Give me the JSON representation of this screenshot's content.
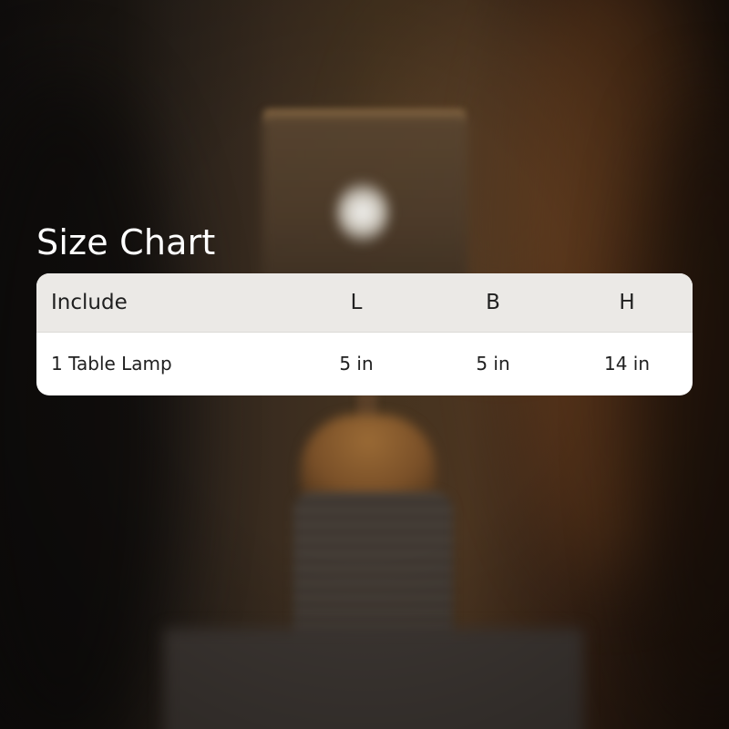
{
  "title": "Size Chart",
  "table": {
    "headers": {
      "include": "Include",
      "l": "L",
      "b": "B",
      "h": "H"
    },
    "rows": [
      {
        "include": "1 Table Lamp",
        "l": "5 in",
        "b": "5 in",
        "h": "14 in"
      }
    ]
  },
  "colors": {
    "title_text": "#ffffff",
    "header_bg": "#ebe9e6",
    "row_bg": "#ffffff",
    "table_text": "#202020"
  }
}
